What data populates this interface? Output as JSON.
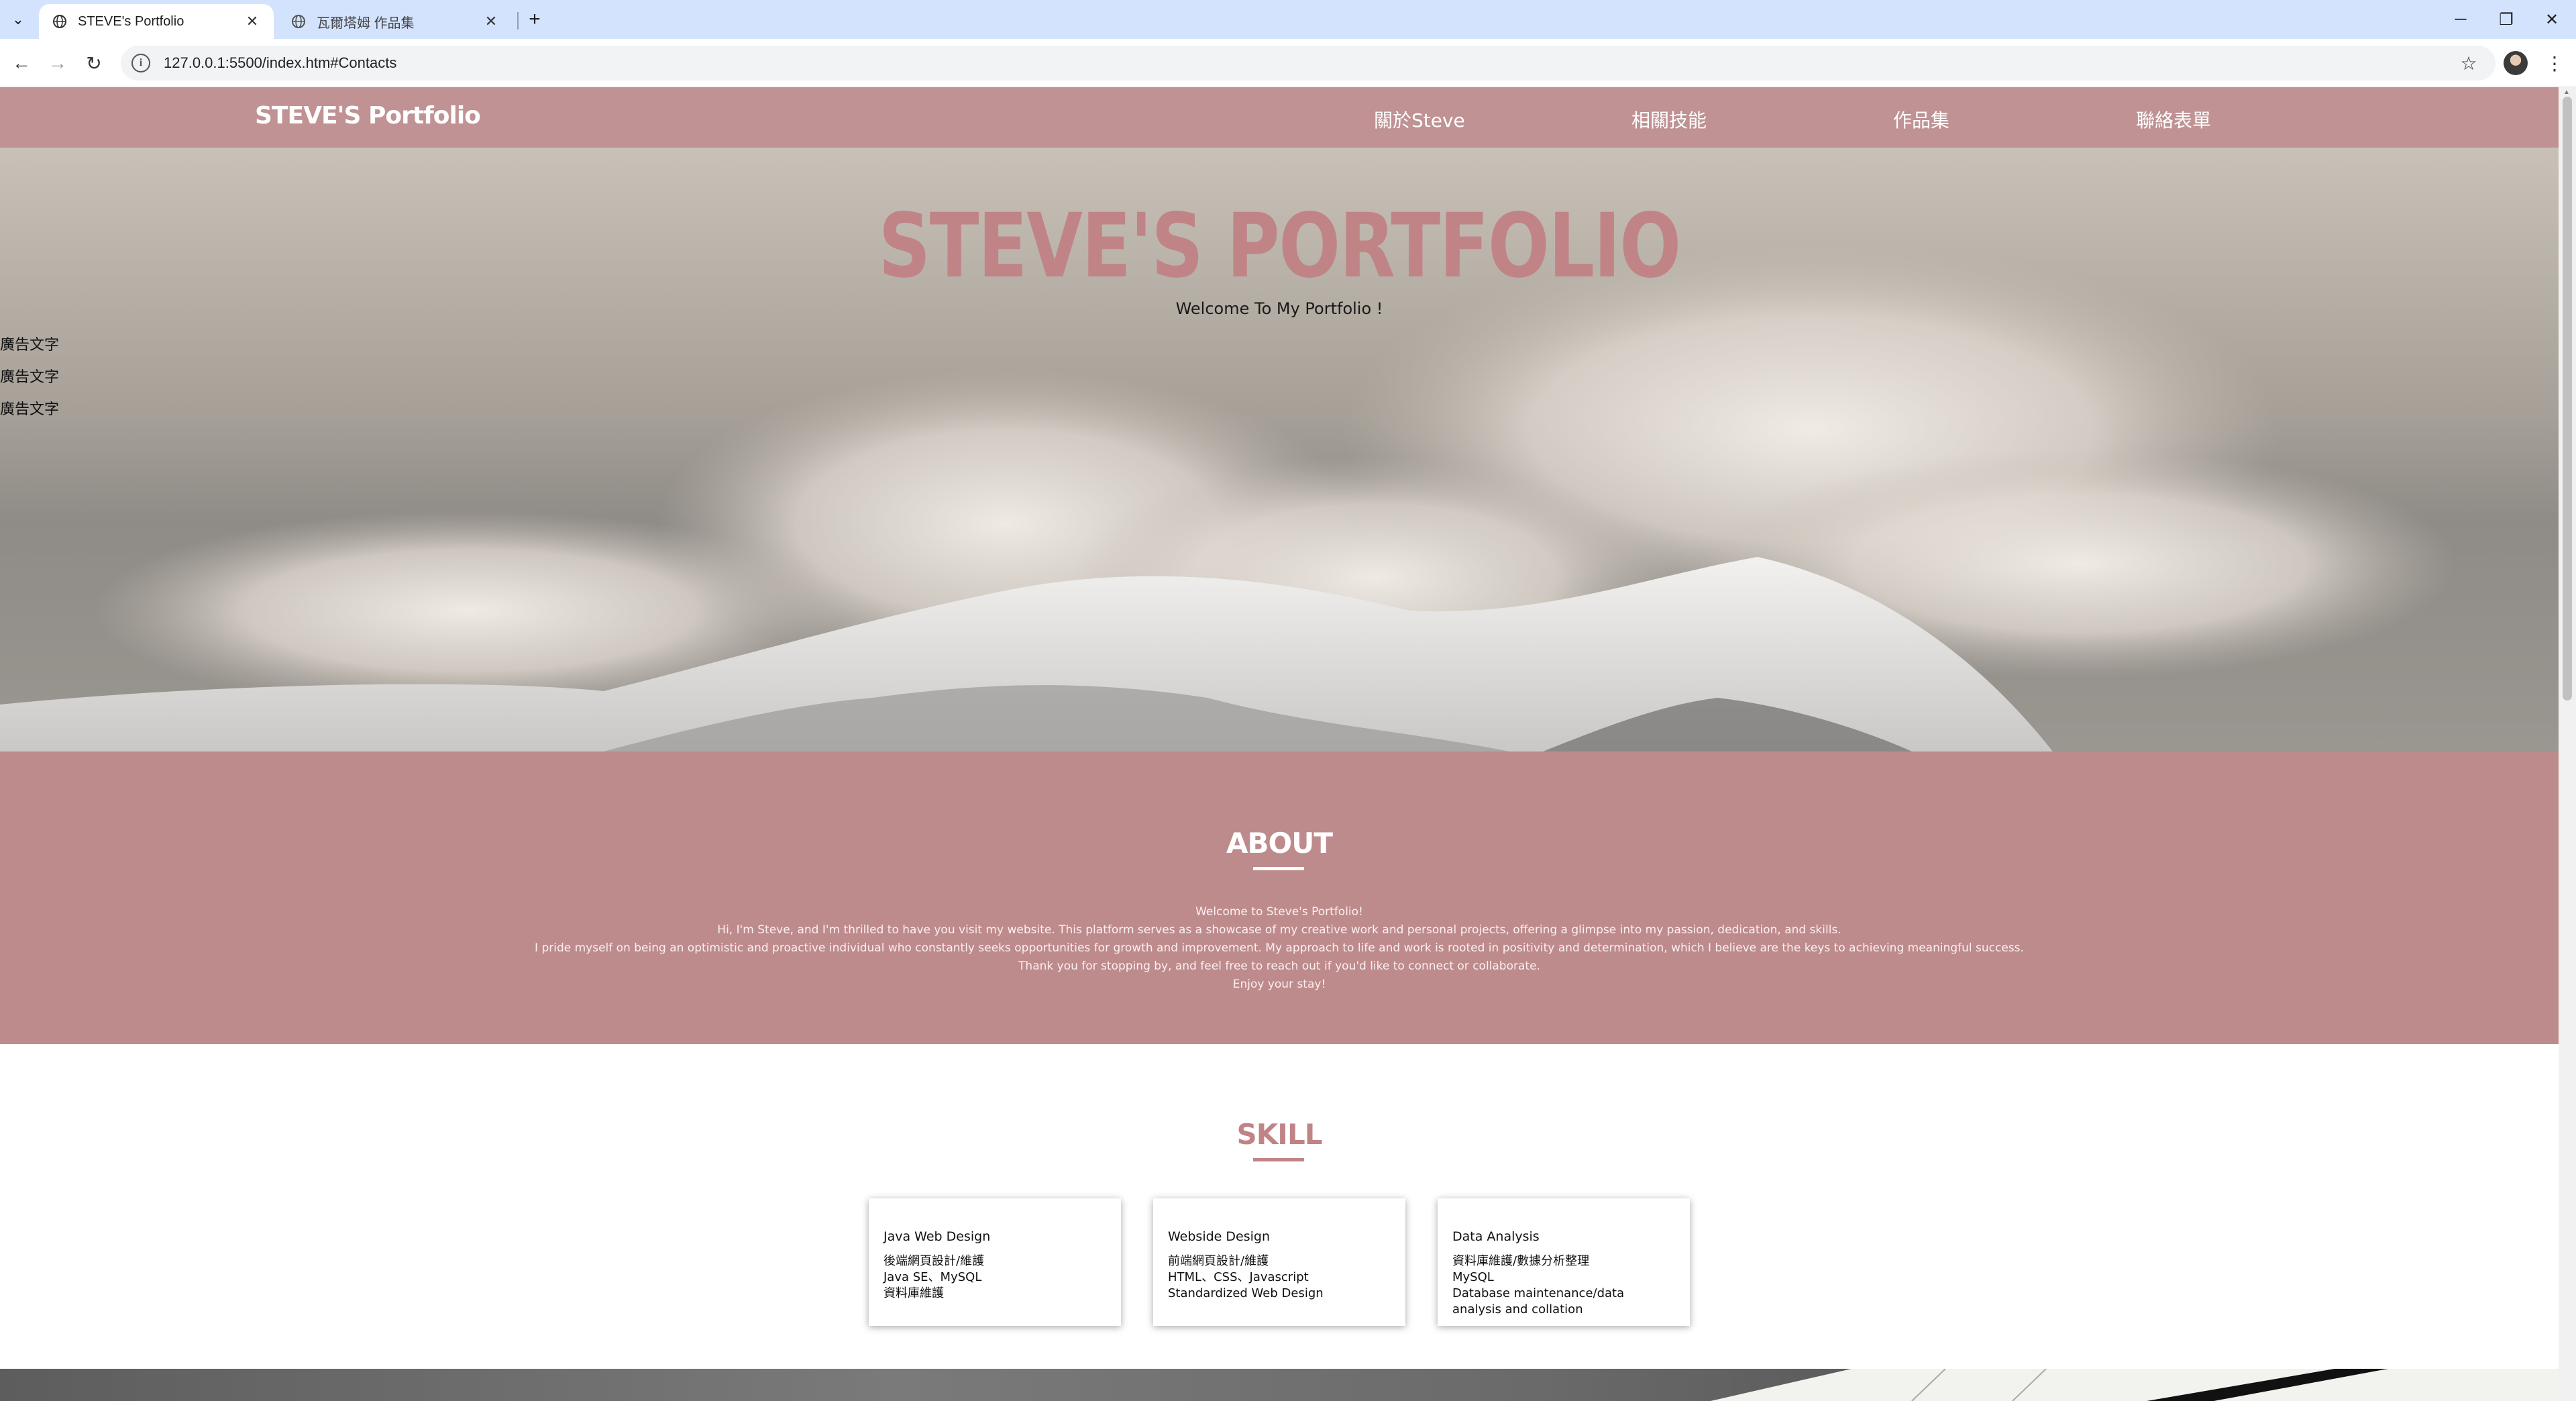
{
  "browser": {
    "tabs": [
      {
        "title": "STEVE's Portfolio",
        "active": true
      },
      {
        "title": "瓦爾塔姆 作品集",
        "active": false
      }
    ],
    "url": "127.0.0.1:5500/index.htm#Contacts",
    "new_tab_symbol": "+",
    "window_controls": {
      "minimize": "─",
      "restore": "❐",
      "close": "✕"
    }
  },
  "site": {
    "brand": "STEVE'S Portfolio",
    "nav": [
      "關於Steve",
      "相關技能",
      "作品集",
      "聯絡表單"
    ],
    "hero": {
      "title": "STEVE'S PORTFOLIO",
      "subtitle": "Welcome To My Portfolio !"
    },
    "ads": [
      "廣告文字",
      "廣告文字",
      "廣告文字"
    ],
    "about": {
      "heading": "ABOUT",
      "lines": [
        "Welcome to Steve's Portfolio!",
        "Hi, I'm Steve, and I'm thrilled to have you visit my website. This platform serves as a showcase of my creative work and personal projects, offering a glimpse into my passion, dedication, and skills.",
        "I pride myself on being an optimistic and proactive individual who constantly seeks opportunities for growth and improvement. My approach to life and work is rooted in positivity and determination, which I believe are the keys to achieving meaningful success.",
        "Thank you for stopping by, and feel free to reach out if you'd like to connect or collaborate.",
        "Enjoy your stay!"
      ]
    },
    "skill": {
      "heading": "SKILL",
      "cards": [
        {
          "title": "Java Web Design",
          "lines": [
            "後端網頁設計/維護",
            "Java SE、MySQL",
            "資料庫維護"
          ]
        },
        {
          "title": "Webside Design",
          "lines": [
            "前端網頁設計/維護",
            "HTML、CSS、Javascript",
            "Standardized Web Design"
          ]
        },
        {
          "title": "Data Analysis",
          "lines": [
            "資料庫維護/數據分析整理",
            "MySQL",
            "Database maintenance/data analysis and collation"
          ]
        }
      ]
    }
  },
  "colors": {
    "nav_bg": "#c09294",
    "accent": "#c08487",
    "about_bg": "#be8b8d",
    "tabstrip_bg": "#d3e3fd"
  },
  "icons": [
    "tab-search-icon",
    "globe-icon",
    "close-icon",
    "back-icon",
    "forward-icon",
    "reload-icon",
    "site-info-icon",
    "bookmark-star-icon",
    "profile-avatar-icon",
    "more-menu-icon"
  ]
}
